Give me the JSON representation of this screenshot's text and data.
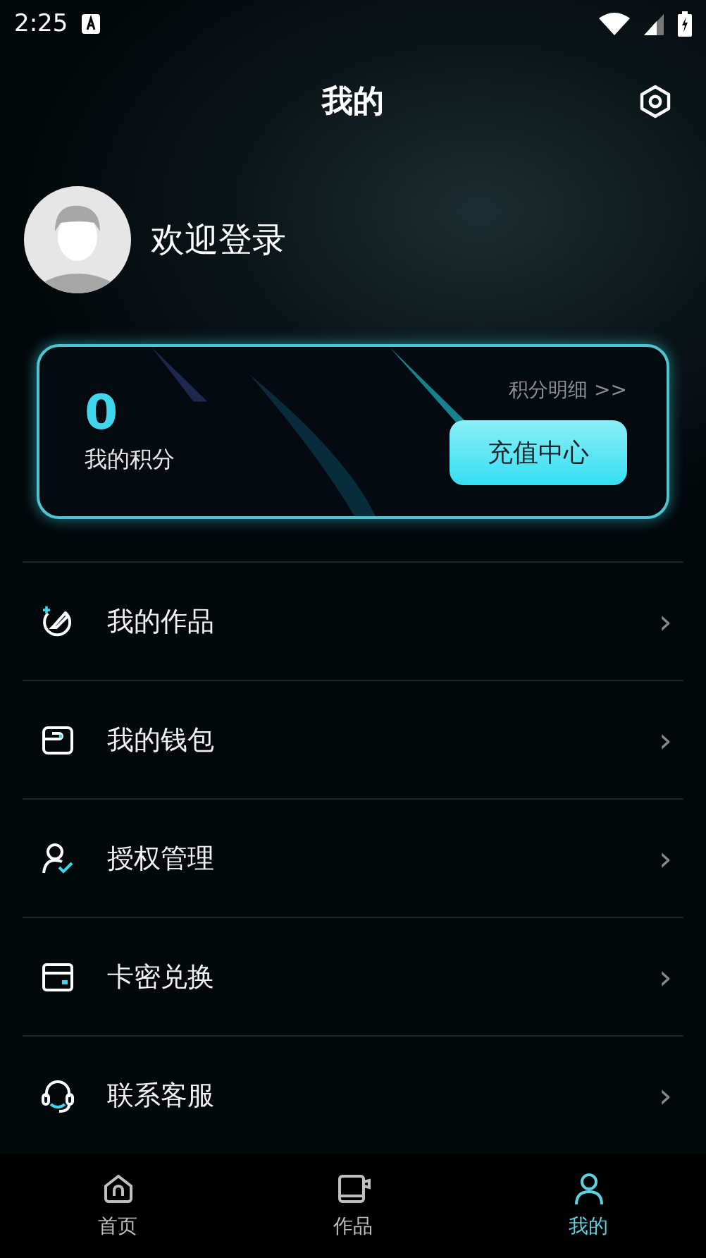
{
  "status_bar": {
    "time": "2:25"
  },
  "header": {
    "title": "我的"
  },
  "profile": {
    "greeting": "欢迎登录"
  },
  "points_card": {
    "value": "0",
    "label": "我的积分",
    "detail_link": "积分明细 >>",
    "recharge_button": "充值中心"
  },
  "menu": [
    {
      "label": "我的作品",
      "chevron": "›"
    },
    {
      "label": "我的钱包",
      "chevron": "›"
    },
    {
      "label": "授权管理",
      "chevron": "›"
    },
    {
      "label": "卡密兑换",
      "chevron": "›"
    },
    {
      "label": "联系客服",
      "chevron": "›"
    }
  ],
  "tabs": [
    {
      "label": "首页",
      "selected": false
    },
    {
      "label": "作品",
      "selected": false
    },
    {
      "label": "我的",
      "selected": true
    }
  ]
}
